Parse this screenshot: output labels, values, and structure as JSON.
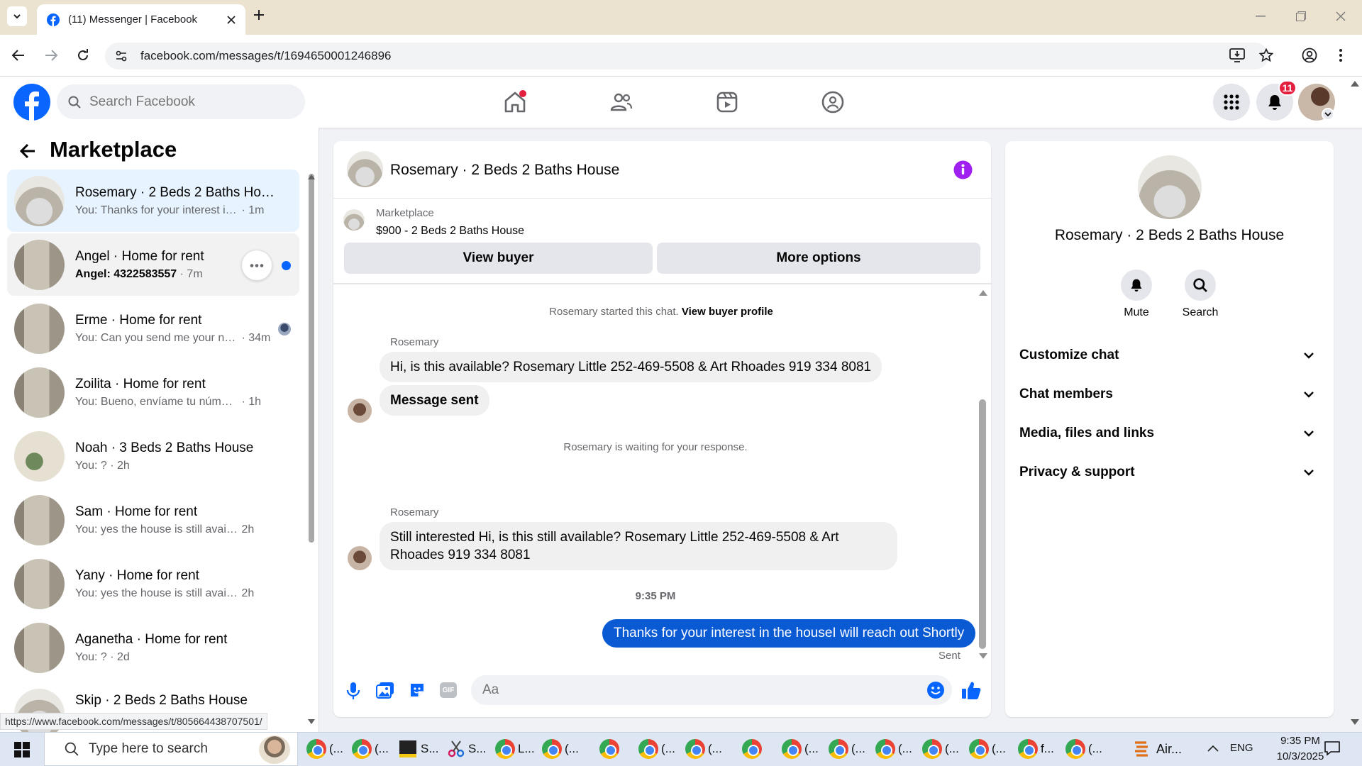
{
  "browser": {
    "tab_title": "(11) Messenger | Facebook",
    "url": "facebook.com/messages/t/1694650001246896",
    "status_url": "https://www.facebook.com/messages/t/805664438707501/"
  },
  "header": {
    "search_placeholder": "Search Facebook",
    "notification_count": "11"
  },
  "sidebar": {
    "title": "Marketplace",
    "conversations": [
      {
        "name": "Rosemary · 2 Beds 2 Baths House",
        "snippet": "You: Thanks for your interest in the...",
        "time": "· 1m"
      },
      {
        "name": "Angel · Home for rent",
        "snippet": "Angel: 4322583557",
        "time": "· 7m"
      },
      {
        "name": "Erme · Home for rent",
        "snippet": "You: Can you send me your nu...",
        "time": "· 34m"
      },
      {
        "name": "Zoilita · Home for rent",
        "snippet": "You: Bueno, envíame tu número pa...",
        "time": "· 1h"
      },
      {
        "name": "Noah · 3 Beds 2 Baths House",
        "snippet": "You: ?",
        "time": "· 2h"
      },
      {
        "name": "Sam · Home for rent",
        "snippet": "You: yes the house is still available f...",
        "time": "2h"
      },
      {
        "name": "Yany · Home for rent",
        "snippet": "You: yes the house is still available f...",
        "time": "2h"
      },
      {
        "name": "Aganetha · Home for rent",
        "snippet": "You: ?",
        "time": "· 2d"
      },
      {
        "name": "Skip · 2 Beds 2 Baths House",
        "snippet": "",
        "time": ""
      }
    ]
  },
  "chat": {
    "title": "Rosemary · 2 Beds 2 Baths House",
    "listing_label": "Marketplace",
    "listing_detail": "$900 - 2 Beds 2 Baths House",
    "view_buyer": "View buyer",
    "more_options": "More options",
    "started_text": "Rosemary started this chat.",
    "view_buyer_profile": "View buyer profile",
    "sender1": "Rosemary",
    "msg1": "Hi, is this available? Rosemary Little 252-469-5508  & Art Rhoades 919 334 8081",
    "msg2": "Message sent",
    "waiting_text": "Rosemary is waiting for your response.",
    "sender2": "Rosemary",
    "msg3": "Still interested Hi, is this still available? Rosemary Little 252-469-5508  & Art Rhoades 919 334 8081",
    "time_divider": "9:35 PM",
    "msg_out": "Thanks for your interest in the houseI will reach out Shortly",
    "sent_label": "Sent",
    "composer_placeholder": "Aa"
  },
  "info_panel": {
    "title": "Rosemary · 2 Beds 2 Baths House",
    "mute_label": "Mute",
    "search_label": "Search",
    "sections": [
      "Customize chat",
      "Chat members",
      "Media, files and links",
      "Privacy & support"
    ]
  },
  "taskbar": {
    "search_placeholder": "Type here to search",
    "apps": [
      "(...",
      "(...",
      "S...",
      "S...",
      "L...",
      "(...",
      "",
      "(...",
      "(...",
      "",
      "(...",
      "(...",
      "(...",
      "(...",
      "(...",
      "f...",
      "(..."
    ],
    "air_label": "Air...",
    "lang": "ENG",
    "time": "9:35 PM",
    "date": "10/3/2025"
  },
  "colors": {
    "fb_blue": "#0866ff",
    "bubble_out": "#0a5ad4",
    "unread_dot": "#0866ff",
    "notification_red": "#e41e3f",
    "info_icon": "#a020f0"
  }
}
